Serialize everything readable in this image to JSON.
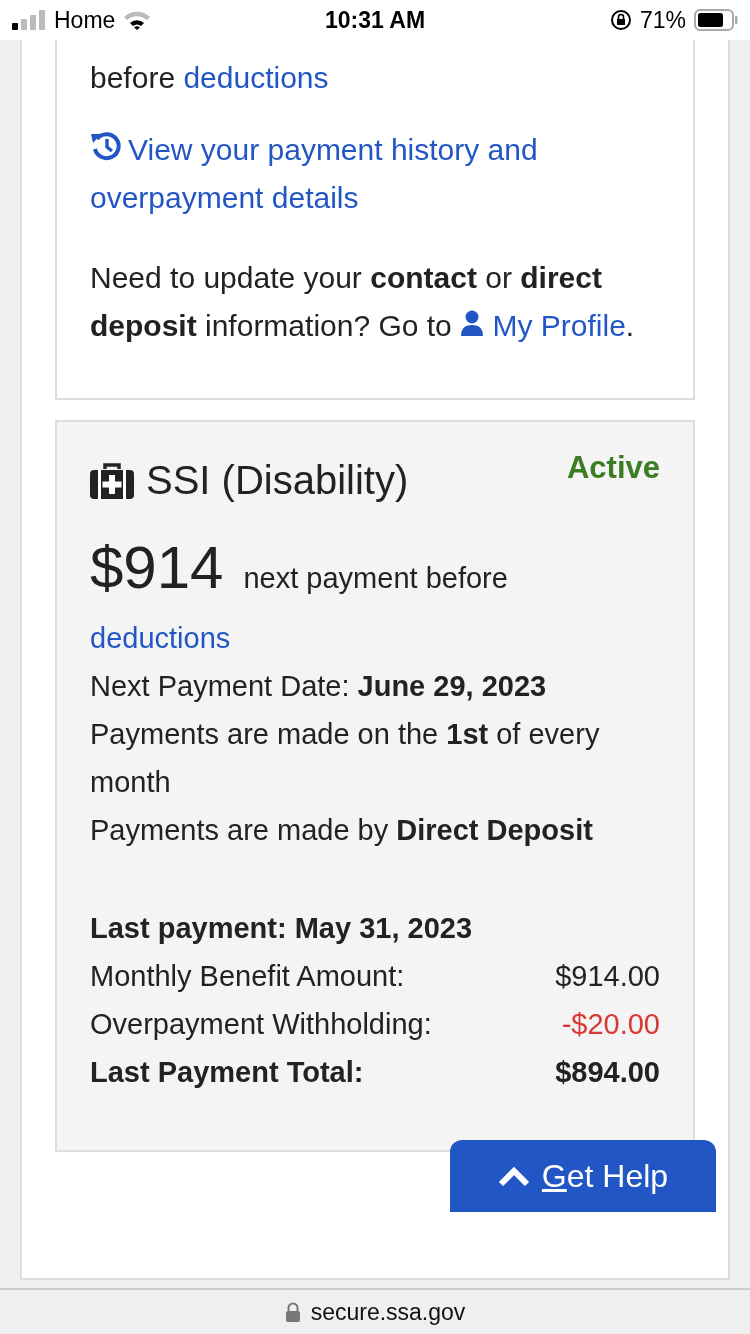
{
  "status_bar": {
    "carrier": "Home",
    "time": "10:31 AM",
    "battery": "71%"
  },
  "payment_card": {
    "intro_text": "before",
    "intro_link": "deductions",
    "history_link": "View your payment history and overpayment details",
    "profile_note": "Need to update your **contact** or **direct deposit** information? Go to",
    "profile_link": "My Profile",
    "profile_end": "."
  },
  "ssi_card": {
    "title": "SSI (Disability)",
    "status": "Active",
    "amount": "$914",
    "amount_caption": "next payment before",
    "deductions_link": "deductions",
    "details": [
      "Next Payment Date: **June 29, 2023**",
      "Payments are made on the **1st** of every month",
      "Payments are made by **Direct Deposit**"
    ],
    "last_payment_heading": "Last payment: May 31, 2023",
    "rows": [
      {
        "kind": "normal",
        "label": "Monthly Benefit Amount:",
        "value": "$914.00"
      },
      {
        "kind": "negative",
        "label": "Overpayment Withholding:",
        "value": "-$20.00"
      },
      {
        "kind": "total",
        "label": "Last Payment Total:",
        "value": "$894.00"
      }
    ]
  },
  "help_button": {
    "label": "Get Help"
  },
  "address_bar": {
    "url": "secure.ssa.gov"
  }
}
